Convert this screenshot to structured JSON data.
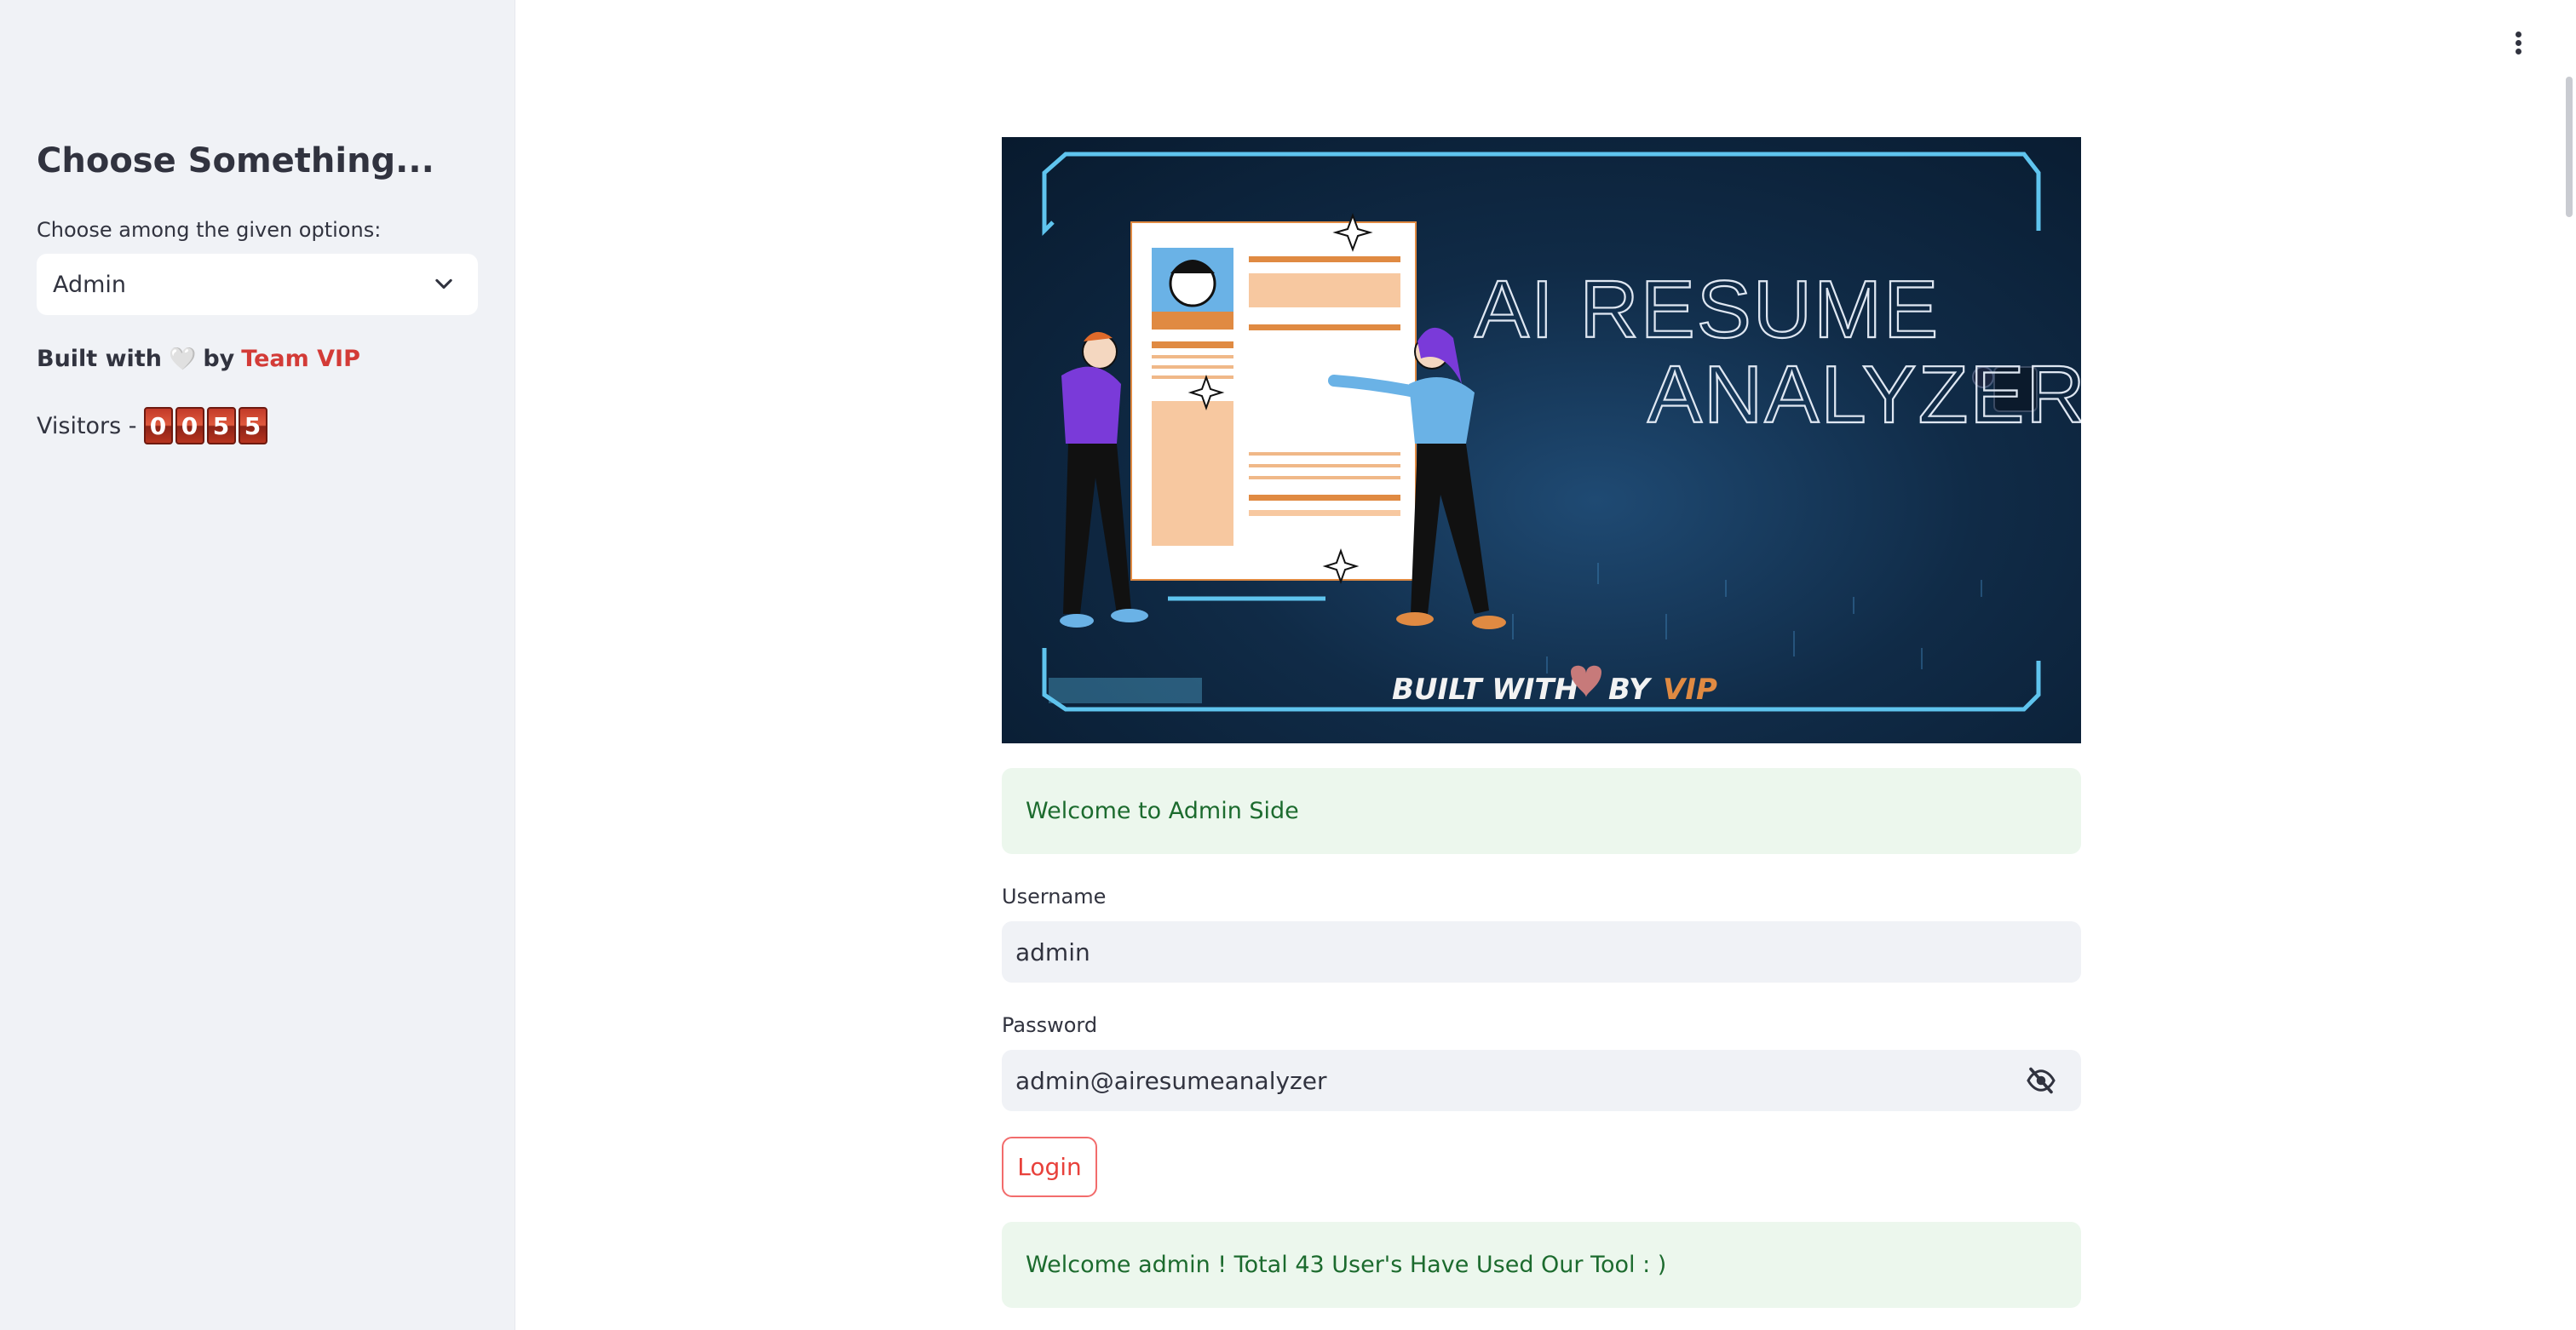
{
  "sidebar": {
    "title": "Choose Something...",
    "select_label": "Choose among the given options:",
    "select_value": "Admin",
    "built_with": "Built with",
    "heart": "🤍",
    "by": "by",
    "team": "Team VIP",
    "visitors_label": "Visitors -",
    "visitor_digits": [
      "0",
      "0",
      "5",
      "5"
    ]
  },
  "banner": {
    "title_line1": "AI RESUME",
    "title_line2": "ANALYZER",
    "footer_built": "BUILT WITH",
    "footer_by": "BY",
    "footer_vip": "VIP"
  },
  "main": {
    "welcome_alert": "Welcome to Admin Side",
    "username_label": "Username",
    "username_value": "admin",
    "password_label": "Password",
    "password_value": "admin@airesumeanalyzer",
    "login_label": "Login",
    "total_alert": "Welcome admin ! Total 43 User's Have Used Our Tool : )"
  },
  "colors": {
    "accent": "#e8413b",
    "success_bg": "#ecf7ed",
    "success_text": "#1c6b2e",
    "sidebar_bg": "#f0f2f6"
  },
  "icons": [
    "chevron-down-icon",
    "kebab-menu-icon",
    "eye-slash-icon"
  ]
}
